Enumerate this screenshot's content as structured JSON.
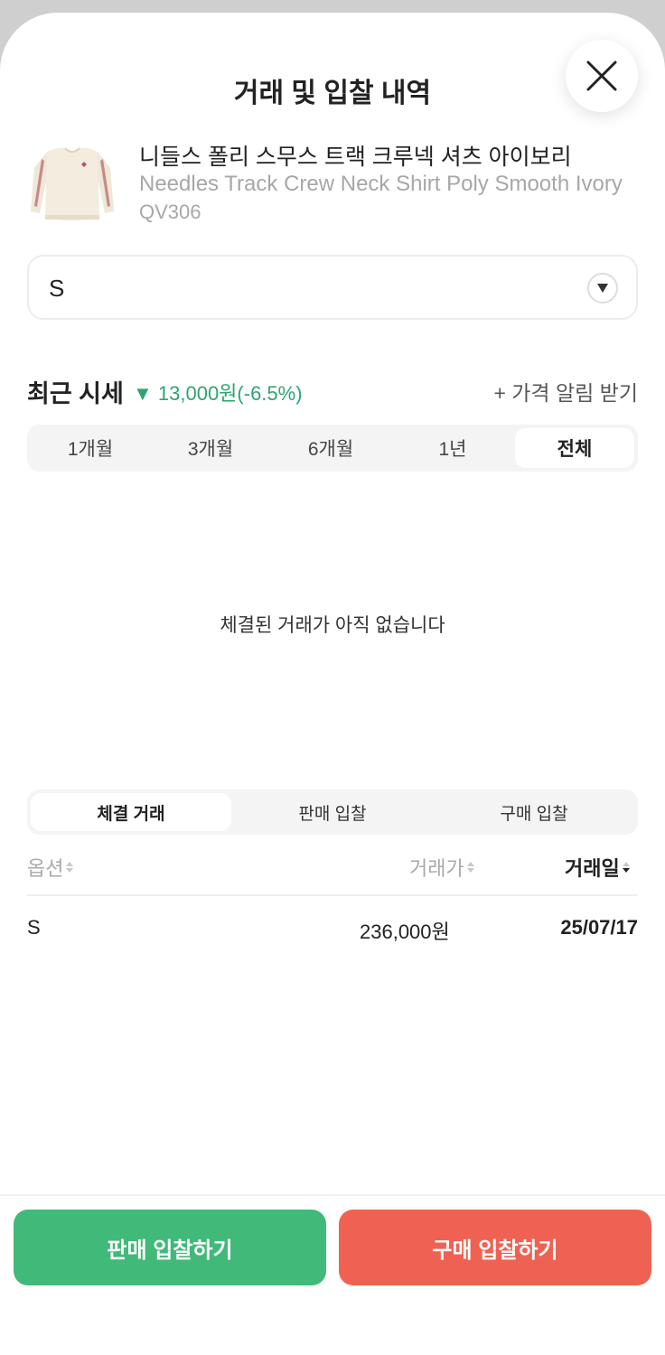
{
  "header": {
    "title": "거래 및 입찰 내역",
    "close_icon": "close-icon"
  },
  "product": {
    "name_ko": "니들스 폴리 스무스 트랙 크루넥 셔츠 아이보리",
    "name_en": "Needles Track Crew Neck Shirt Poly Smooth Ivory",
    "code": "QV306",
    "image_icon": "sweatshirt-thumbnail"
  },
  "size_select": {
    "value": "S",
    "icon": "triangle-down-icon"
  },
  "recent_price": {
    "title": "최근 시세",
    "change": "▼ 13,000원(-6.5%)",
    "change_color": "#2fa46f",
    "alert_label": "+ 가격 알림 받기"
  },
  "period_tabs": [
    {
      "label": "1개월",
      "active": false
    },
    {
      "label": "3개월",
      "active": false
    },
    {
      "label": "6개월",
      "active": false
    },
    {
      "label": "1년",
      "active": false
    },
    {
      "label": "전체",
      "active": true
    }
  ],
  "chart": {
    "empty_message": "체결된 거래가 아직 없습니다"
  },
  "trade_tabs": [
    {
      "label": "체결 거래",
      "active": true
    },
    {
      "label": "판매 입찰",
      "active": false
    },
    {
      "label": "구매 입찰",
      "active": false
    }
  ],
  "table": {
    "headers": {
      "option": "옵션",
      "price": "거래가",
      "date": "거래일"
    },
    "rows": [
      {
        "option": "S",
        "price": "236,000원",
        "date": "25/07/17"
      }
    ]
  },
  "actions": {
    "sell_label": "판매 입찰하기",
    "sell_color": "#41b979",
    "buy_label": "구매 입찰하기",
    "buy_color": "#ef6253"
  }
}
